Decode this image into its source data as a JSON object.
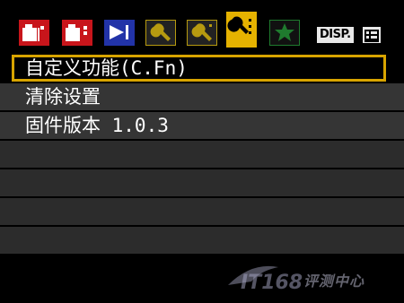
{
  "tabs": [
    {
      "name": "shooting-1",
      "color": "#c8151b",
      "icon": "camera-icon"
    },
    {
      "name": "shooting-2",
      "color": "#c8151b",
      "icon": "camera-icon"
    },
    {
      "name": "playback",
      "color": "#2233a8",
      "icon": "play-icon"
    },
    {
      "name": "setup-1",
      "color": "#b69a10",
      "icon": "wrench-icon"
    },
    {
      "name": "setup-2",
      "color": "#b69a10",
      "icon": "wrench-icon"
    },
    {
      "name": "setup-3",
      "color": "#e5b200",
      "icon": "wrench-icon",
      "active": true
    },
    {
      "name": "my-menu",
      "color": "#1f7a2e",
      "icon": "star-icon"
    }
  ],
  "header": {
    "disp_label": "DISP."
  },
  "menu": {
    "items": [
      {
        "label": "自定义功能(C.Fn)",
        "selected": true
      },
      {
        "label": "清除设置"
      },
      {
        "label": "固件版本 1.0.3"
      }
    ]
  },
  "watermark": {
    "text": "评测中心",
    "brand": "IT168"
  }
}
